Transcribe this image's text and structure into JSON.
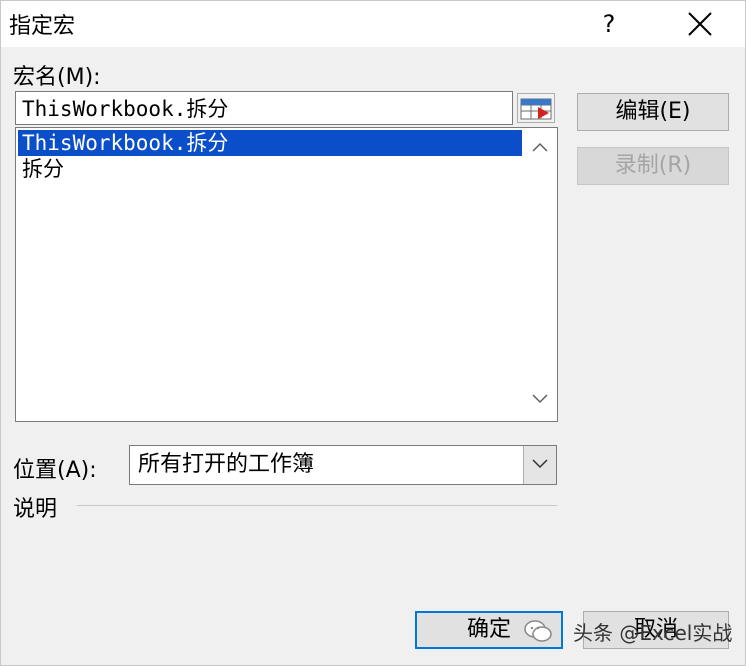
{
  "window": {
    "title": "指定宏",
    "help": "?",
    "close_icon": "close-icon"
  },
  "macro_name": {
    "label": "宏名(M):",
    "value": "ThisWorkbook.拆分"
  },
  "macro_list": {
    "items": [
      {
        "label": "ThisWorkbook.拆分",
        "selected": true
      },
      {
        "label": "拆分",
        "selected": false
      }
    ]
  },
  "buttons": {
    "edit": "编辑(E)",
    "record": "录制(R)",
    "ok": "确定",
    "cancel": "取消"
  },
  "location": {
    "label": "位置(A):",
    "value": "所有打开的工作簿"
  },
  "description": {
    "label": "说明"
  },
  "watermark": {
    "text": "头条 @Excel实战"
  },
  "colors": {
    "selection": "#0a4ec9",
    "focus_border": "#0078d7"
  }
}
